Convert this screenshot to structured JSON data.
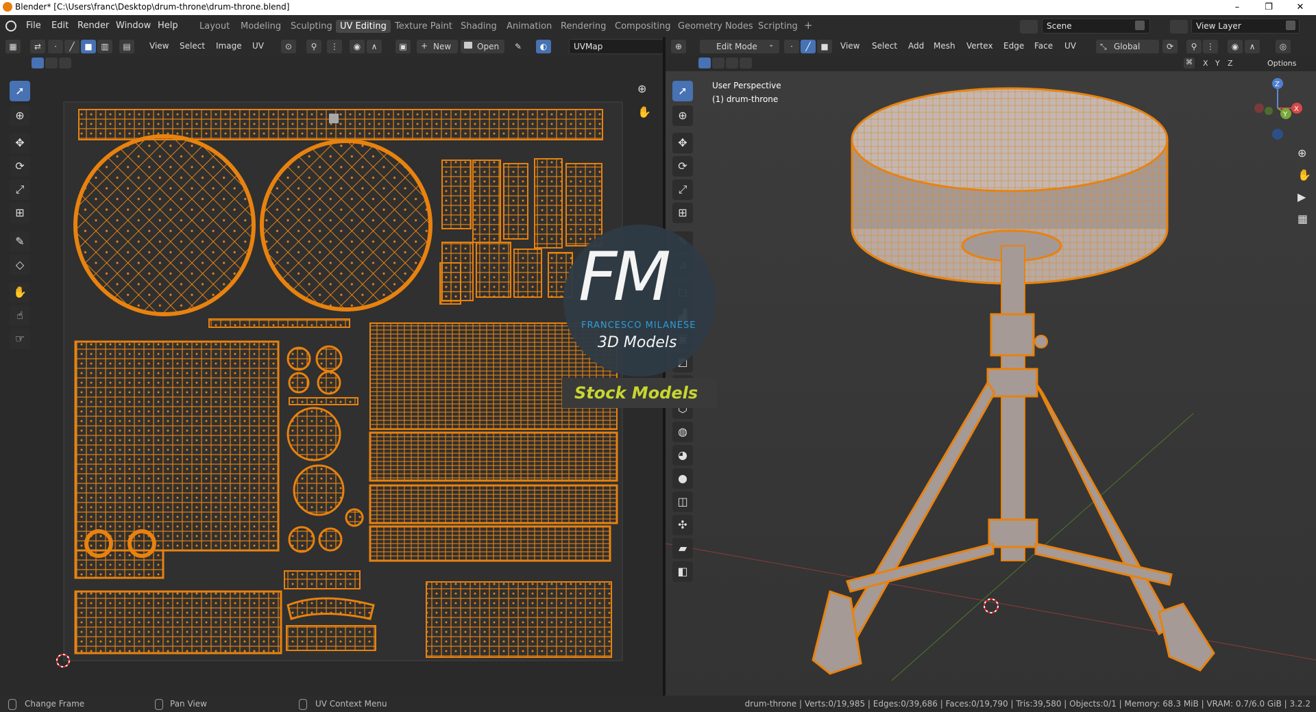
{
  "window": {
    "title": "Blender* [C:\\Users\\franc\\Desktop\\drum-throne\\drum-throne.blend]",
    "minimize": "–",
    "maximize": "❐",
    "close": "✕"
  },
  "menus": [
    "File",
    "Edit",
    "Render",
    "Window",
    "Help"
  ],
  "workspaces": [
    "Layout",
    "Modeling",
    "Sculpting",
    "UV Editing",
    "Texture Paint",
    "Shading",
    "Animation",
    "Rendering",
    "Compositing",
    "Geometry Nodes",
    "Scripting",
    "+"
  ],
  "active_workspace": "UV Editing",
  "scene": {
    "label": "Scene"
  },
  "view_layer": {
    "label": "View Layer"
  },
  "uv_header": {
    "menus": [
      "View",
      "Select",
      "Image",
      "UV"
    ],
    "new_label": "New",
    "open_label": "Open",
    "uvmap": "UVMap"
  },
  "viewport_header": {
    "mode": "Edit Mode",
    "menus": [
      "View",
      "Select",
      "Add",
      "Mesh",
      "Vertex",
      "Edge",
      "Face",
      "UV"
    ],
    "orientation": "Global",
    "options": "Options",
    "axes": [
      "X",
      "Y",
      "Z"
    ]
  },
  "viewport_overlay": {
    "line1": "User Perspective",
    "line2": "(1) drum-throne"
  },
  "gizmo": {
    "x": "X",
    "y": "Y",
    "z": "Z"
  },
  "watermark": {
    "letters": "FM",
    "brand": "FRANCESCO MILANESE",
    "sub": "3D Models",
    "banner": "Stock Models"
  },
  "status": {
    "left1": "Change Frame",
    "left2": "Pan View",
    "left3": "UV Context Menu",
    "right": "drum-throne | Verts:0/19,985 | Edges:0/39,686 | Faces:0/19,790 | Tris:39,580 | Objects:0/1 | Memory: 68.3 MiB | VRAM: 0.7/6.0 GiB | 3.2.2"
  },
  "colors": {
    "accent": "#4772b3",
    "uv_orange": "#e8820f",
    "header": "#2b2b2b"
  }
}
